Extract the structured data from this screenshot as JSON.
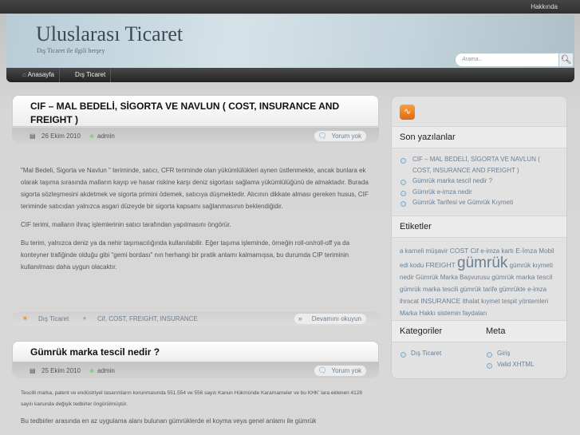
{
  "topbar": {
    "about": "Hakkında"
  },
  "header": {
    "title": "Uluslarası Ticaret",
    "description": "Dış Ticaret ile ilgili herşey",
    "search_placeholder": "Arama..."
  },
  "nav": [
    {
      "label": "Anasayfa"
    },
    {
      "label": "Dış Ticaret"
    }
  ],
  "posts": [
    {
      "title": "CIF – MAL BEDELİ, SİGORTA VE NAVLUN ( COST, INSURANCE AND FREIGHT )",
      "date": "26 Ekim 2010",
      "author": "admin",
      "comments": "Yorum yok",
      "paragraphs": [
        "\"Mal Bedeli, Sigorta ve Navlun \" teriminde, satıcı, CFR teriminde olan yükümlülükleri aynen üstlenmekte, ancak bunlara ek olarak taşıma sırasında malların kayıp ve hasar riskine karşı deniz sigortası sağlama yükümlülüğünü de almaktadır. Burada sigorta sözleşmesini akdetmek ve sigorta primini ödemek, satıcıya düşmektedir. Alıcının dikkate alması gereken husus, CIF teriminde satıcıdan yalnızca asgari düzeyde bir sigorta kapsamı sağlanmasının beklendiğidir.",
        "CIF terimi, malların ihraç işlemlerinin satıcı tarafından yapılmasını öngörür.",
        "Bu terim, yalnızca deniz ya da nehir taşımacılığında kullanılabilir. Eğer taşıma işleminde, örneğin roll-on/roll-off ya da konteyner trafiğinde olduğu gibi \"gemi bordası\" nın herhangi bir pratik anlamı kalmamışsa, bu durumda CIP teriminin kullanılması daha uygun olacaktır."
      ],
      "category": "Dış Ticaret",
      "tags": "Cif, COST, FREIGHT, INSURANCE",
      "read_more": "Devamını okuyun"
    },
    {
      "title": "Gümrük marka tescil nedir ?",
      "date": "25 Ekim 2010",
      "author": "admin",
      "comments": "Yorum yok",
      "paragraphs": [
        "Tescilli marka, patent ve endüstriyel tasarımların korunmasında 551.554 ve 556 sayılı Kanun Hükmünde Kararnameler ve bu KHK' lara eklenen 4128 sayılı kanunda değişik tedbirler öngörülmüştür.",
        "Bu tedbirler arasında en az uygulama alanı bulunan gümrüklerde el koyma veya genel anlamı ile gümrük"
      ]
    }
  ],
  "sidebar": {
    "recent_title": "Son yazılanlar",
    "recent": [
      "CIF – MAL BEDELİ, SİGORTA VE NAVLUN ( COST, INSURANCE AND FREIGHT )",
      "Gümrük marka tescil nedir ?",
      "Gümrük e-imza nedir",
      "Gümrük Tarifesi ve Gümrük Kıymeti"
    ],
    "tags_title": "Etiketler",
    "tags": [
      "a karneli",
      "müşavir",
      "COST",
      "Cif",
      "e-imza kartı",
      "E-İmza",
      "Mobil edi kodu",
      "FREIGHT",
      "gümrük",
      "gümrük kıymeti nedir",
      "Gümrük Marka Başvurusu",
      "gümrük marka tescil",
      "gümrük marka tescili",
      "gümrük tarife",
      "gümrükte e-imza",
      "ihracat",
      "INSURANCE",
      "ithalat",
      "kıymet tespit yöntemleri",
      "Marka Hakkı",
      "sistemin faydaları"
    ],
    "categories_title": "Kategoriler",
    "categories": [
      "Dış Ticaret"
    ],
    "meta_title": "Meta",
    "meta": [
      "Giriş",
      "Valid XHTML"
    ]
  }
}
